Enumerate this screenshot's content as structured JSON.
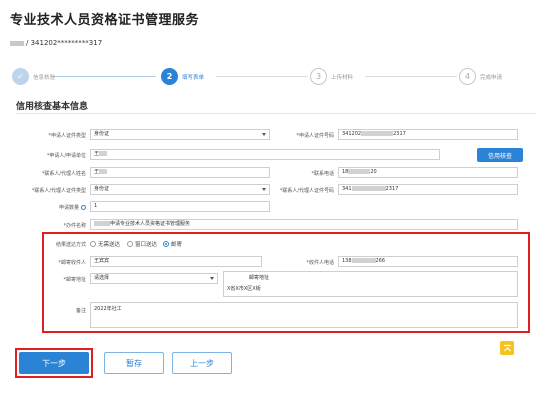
{
  "page_title": "专业技术人员资格证书管理服务",
  "user_id": "/ 341202*********317",
  "steps": [
    {
      "num": "✓",
      "label": "信息核验",
      "state": "done"
    },
    {
      "num": "2",
      "label": "填写表单",
      "state": "active"
    },
    {
      "num": "3",
      "label": "上传材料",
      "state": "todo"
    },
    {
      "num": "4",
      "label": "完成申请",
      "state": "todo"
    }
  ],
  "section_title": "信用核查基本信息",
  "form": {
    "applicant_id_type_label": "*申请人证件类型",
    "applicant_id_type_value": "身份证",
    "applicant_id_no_label": "*申请人证件号码",
    "applicant_id_no_prefix": "341202",
    "applicant_id_no_suffix": "2317",
    "applicant_name_label": "*申请人/申请单位",
    "applicant_name_value": "王",
    "check_button": "信用核查",
    "contact_name_label": "*联系人/代理人姓名",
    "contact_name_value": "王",
    "contact_phone_label": "*联系电话",
    "contact_phone_prefix": "18",
    "contact_phone_suffix": "20",
    "contact_id_type_label": "*联系人/代理人证件类型",
    "contact_id_type_value": "身份证",
    "contact_id_no_label": "*联系人/代理人证件号码",
    "contact_id_no_prefix": "341",
    "contact_id_no_suffix": "2317",
    "apply_count_label": "申请数量",
    "apply_count_value": "1",
    "item_name_label": "*办件名称",
    "item_name_value": "申请专业技术人员资格证书管理服务",
    "delivery_label": "结果送达方式",
    "delivery_options": [
      "无需送达",
      "窗口送达",
      "邮寄"
    ],
    "recipient_label": "*邮寄收件人",
    "recipient_value": "王宾宾",
    "recipient_phone_label": "*收件人电话",
    "recipient_phone_prefix": "138",
    "recipient_phone_suffix": "266",
    "address_label": "*邮寄地址",
    "address_select": "请选择",
    "address_detail_label": "邮寄地址",
    "address_detail_value": "X省X市X区X街",
    "remark_label": "备注",
    "remark_value": "2022年社工"
  },
  "buttons": {
    "next": "下一步",
    "save": "暂存",
    "prev": "上一步"
  },
  "colors": {
    "accent": "#2b83d6",
    "highlight_border": "#e02020",
    "back_to_top": "#f5c220"
  }
}
